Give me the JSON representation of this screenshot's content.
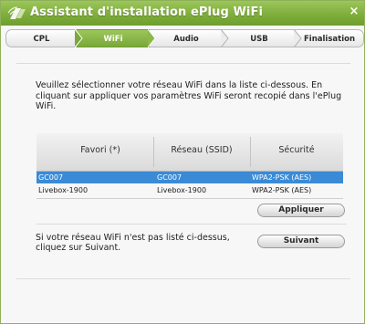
{
  "window": {
    "title": "Assistant d'installation ePlug WiFi",
    "close_symbol": "×"
  },
  "steps": [
    {
      "label": "CPL"
    },
    {
      "label": "WiFi"
    },
    {
      "label": "Audio"
    },
    {
      "label": "USB"
    },
    {
      "label": "Finalisation"
    }
  ],
  "active_step": "WiFi",
  "intro": "Veuillez sélectionner votre réseau WiFi dans la liste ci-dessous. En cliquant sur appliquer vos paramètres WiFi seront recopié dans l'ePlug WiFi.",
  "table": {
    "headers": [
      "Favori (*)",
      "Réseau (SSID)",
      "Sécurité"
    ],
    "rows": [
      {
        "favori": "GC007",
        "ssid": "GC007",
        "security": "WPA2-PSK (AES)",
        "selected": true
      },
      {
        "favori": "Livebox-1900",
        "ssid": "Livebox-1900",
        "security": "WPA2-PSK (AES)",
        "selected": false
      }
    ]
  },
  "buttons": {
    "apply": "Appliquer",
    "next": "Suivant"
  },
  "note": "Si votre réseau WiFi n'est pas listé ci-dessus, cliquez sur Suivant.",
  "colors": {
    "brand_green": "#7fae3c",
    "selection_blue": "#3a8ad6"
  },
  "icons": {
    "app_logo": "eplug-wifi-logo-icon",
    "close": "close-icon"
  }
}
